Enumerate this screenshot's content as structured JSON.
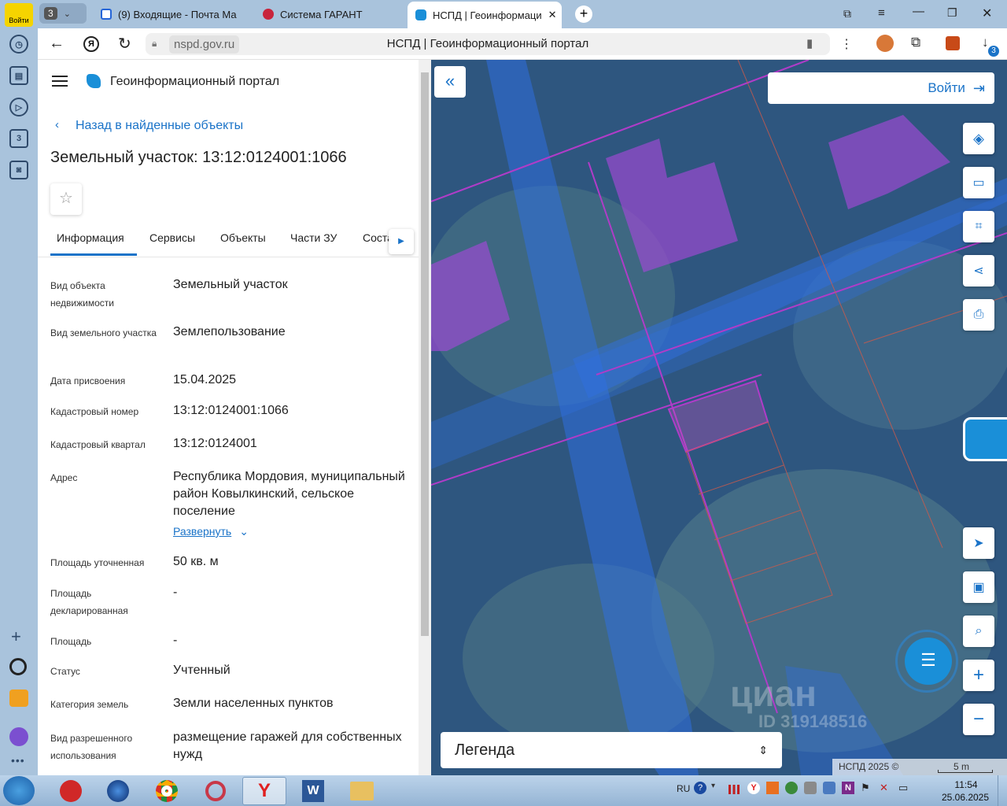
{
  "browser": {
    "sidebar_login": "Войти",
    "tab_group_count": "3",
    "tabs": [
      {
        "title": "(9) Входящие - Почта Ма"
      },
      {
        "title": "Система ГАРАНТ"
      },
      {
        "title": "НСПД | Геоинформаци"
      }
    ],
    "url": "nspd.gov.ru",
    "page_title": "НСПД | Геоинформационный портал",
    "downloads_badge": "3",
    "side_tab_count": "3"
  },
  "portal": {
    "name": "Геоинформационный портал",
    "back_link": "Назад в найденные объекты",
    "object_title": "Земельный участок: 13:12:0124001:1066",
    "tabs": [
      "Информация",
      "Сервисы",
      "Объекты",
      "Части ЗУ",
      "Соста"
    ],
    "fields": [
      {
        "label": "Вид объекта недвижимости",
        "value": "Земельный участок"
      },
      {
        "label": "Вид земельного участка",
        "value": "Землепользование"
      },
      {
        "label": "Дата присвоения",
        "value": "15.04.2025"
      },
      {
        "label": "Кадастровый номер",
        "value": "13:12:0124001:1066"
      },
      {
        "label": "Кадастровый квартал",
        "value": "13:12:0124001"
      },
      {
        "label": "Адрес",
        "value": "Республика Мордовия, муниципальный район Ковылкинский, сельское поселение"
      },
      {
        "label": "Площадь уточненная",
        "value": "50 кв. м"
      },
      {
        "label": "Площадь декларированная",
        "value": "-"
      },
      {
        "label": "Площадь",
        "value": "-"
      },
      {
        "label": "Статус",
        "value": "Учтенный"
      },
      {
        "label": "Категория земель",
        "value": "Земли населенных пунктов"
      },
      {
        "label": "Вид разрешенного использования",
        "value": "размещение гаражей для собственных нужд"
      }
    ],
    "expand_link": "Развернуть"
  },
  "map": {
    "login_button": "Войти",
    "legend_label": "Легенда",
    "watermark_brand": "циан",
    "watermark_id": "ID 319148516",
    "copyright": "НСПД 2025 ©",
    "scale": "5 m"
  },
  "taskbar": {
    "lang": "RU",
    "time": "11:54",
    "date": "25.06.2025"
  },
  "colors": {
    "accent": "#1a73c8",
    "tab_strip": "#a9c3dc",
    "parcel_purple": "#b03cc8",
    "road_blue": "#2f6fe0"
  }
}
